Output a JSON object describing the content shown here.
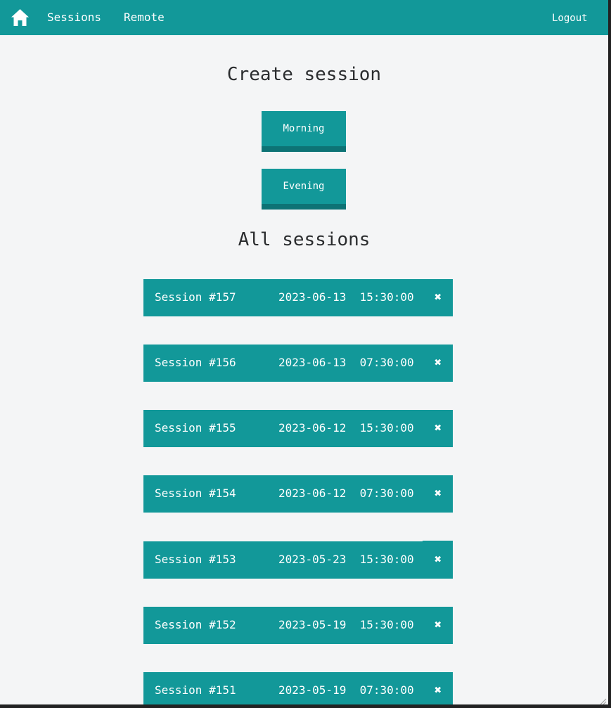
{
  "nav": {
    "home_icon": "home-icon",
    "sessions_label": "Sessions",
    "remote_label": "Remote",
    "logout_label": "Logout"
  },
  "create": {
    "heading": "Create session",
    "morning_label": "Morning",
    "evening_label": "Evening"
  },
  "sessions": {
    "heading": "All sessions",
    "delete_icon": "close-icon",
    "delete_glyph": "✖",
    "items": [
      {
        "name": "Session #157",
        "date": "2023-06-13",
        "time": "15:30:00"
      },
      {
        "name": "Session #156",
        "date": "2023-06-13",
        "time": "07:30:00"
      },
      {
        "name": "Session #155",
        "date": "2023-06-12",
        "time": "15:30:00"
      },
      {
        "name": "Session #154",
        "date": "2023-06-12",
        "time": "07:30:00"
      },
      {
        "name": "Session #153",
        "date": "2023-05-23",
        "time": "15:30:00"
      },
      {
        "name": "Session #152",
        "date": "2023-05-19",
        "time": "15:30:00"
      },
      {
        "name": "Session #151",
        "date": "2023-05-19",
        "time": "07:30:00"
      }
    ]
  },
  "colors": {
    "accent": "#129899",
    "accent_dark": "#0d7375",
    "background": "#f4f5f6",
    "text_dark": "#2b2d2f"
  }
}
